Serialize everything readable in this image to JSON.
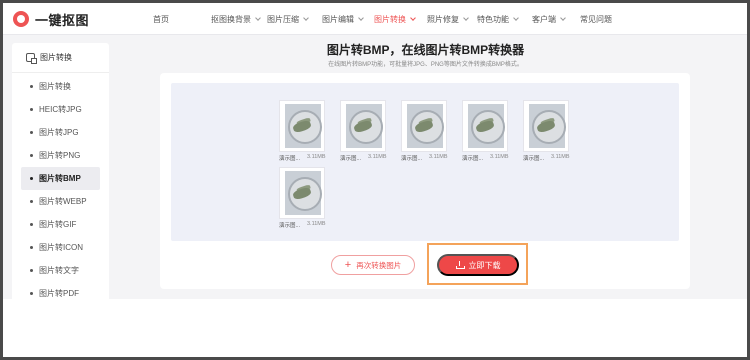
{
  "brand": {
    "name": "一键抠图"
  },
  "nav": [
    {
      "label": "首页",
      "chevron": false,
      "active": false
    },
    {
      "label": "抠图换背景",
      "chevron": true,
      "active": false
    },
    {
      "label": "图片压缩",
      "chevron": true,
      "active": false
    },
    {
      "label": "图片编辑",
      "chevron": true,
      "active": false
    },
    {
      "label": "图片转换",
      "chevron": true,
      "active": true
    },
    {
      "label": "照片修复",
      "chevron": true,
      "active": false
    },
    {
      "label": "特色功能",
      "chevron": true,
      "active": false
    },
    {
      "label": "客户端",
      "chevron": true,
      "active": false
    },
    {
      "label": "常见问题",
      "chevron": false,
      "active": false
    }
  ],
  "sidebar": {
    "title": "图片转换",
    "items": [
      {
        "label": "图片转换",
        "active": false
      },
      {
        "label": "HEIC转JPG",
        "active": false
      },
      {
        "label": "图片转JPG",
        "active": false
      },
      {
        "label": "图片转PNG",
        "active": false
      },
      {
        "label": "图片转BMP",
        "active": true
      },
      {
        "label": "图片转WEBP",
        "active": false
      },
      {
        "label": "图片转GIF",
        "active": false
      },
      {
        "label": "图片转ICON",
        "active": false
      },
      {
        "label": "图片转文字",
        "active": false
      },
      {
        "label": "图片转PDF",
        "active": false
      }
    ]
  },
  "main": {
    "title": "图片转BMP，在线图片转BMP转换器",
    "subtitle": "在线图片转BMP功能，可批量将JPG、PNG等图片文件转换成BMP格式。",
    "files": [
      {
        "name": "演示图...",
        "size": "3.11MB"
      },
      {
        "name": "演示图...",
        "size": "3.11MB"
      },
      {
        "name": "演示图...",
        "size": "3.11MB"
      },
      {
        "name": "演示图...",
        "size": "3.11MB"
      },
      {
        "name": "演示图...",
        "size": "3.11MB"
      },
      {
        "name": "演示图...",
        "size": "3.11MB"
      }
    ],
    "again_label": "再次转换图片",
    "download_label": "立即下载"
  },
  "colors": {
    "accent": "#ee5454",
    "highlight": "#f4a35a"
  }
}
